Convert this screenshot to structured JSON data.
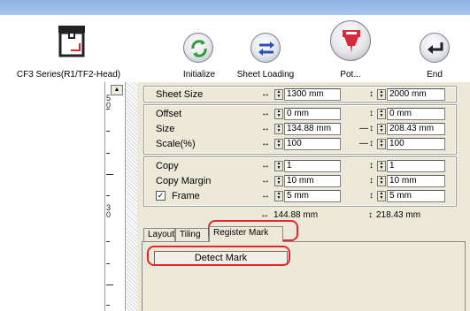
{
  "toolbar": {
    "device_label": "CF3 Series(R1/TF2-Head)",
    "buttons": [
      {
        "label": "Initialize",
        "icon": "initialize-icon"
      },
      {
        "label": "Sheet Loading",
        "icon": "sheet-loading-icon"
      },
      {
        "label": "Pot...",
        "icon": "pot-icon"
      },
      {
        "label": "End",
        "icon": "end-icon"
      }
    ]
  },
  "ruler": {
    "numbers": [
      "5\n0",
      "3\n0"
    ]
  },
  "settings": {
    "sheet_size": {
      "label": "Sheet Size",
      "x": "1300 mm",
      "y": "2000 mm"
    },
    "offset": {
      "label": "Offset",
      "x": "0 mm",
      "y": "0 mm"
    },
    "size": {
      "label": "Size",
      "x": "134.88 mm",
      "y": "208.43 mm"
    },
    "scale": {
      "label": "Scale(%)",
      "x": "100",
      "y": "100"
    },
    "copy": {
      "label": "Copy",
      "x": "1",
      "y": "1"
    },
    "copy_margin": {
      "label": "Copy Margin",
      "x": "10 mm",
      "y": "10 mm"
    },
    "frame": {
      "label": "Frame",
      "checked": "✓",
      "x": "5 mm",
      "y": "5 mm"
    },
    "total": {
      "x": "144.88 mm",
      "y": "218.43 mm"
    }
  },
  "tabs": [
    "Layout",
    "Tiling",
    "Register Mark"
  ],
  "register_mark": {
    "detect_label": "Detect Mark"
  },
  "colors": {
    "highlight": "#e8252c",
    "toolbar_bg": "#ffffff",
    "panel_bg": "#ece9d8"
  }
}
